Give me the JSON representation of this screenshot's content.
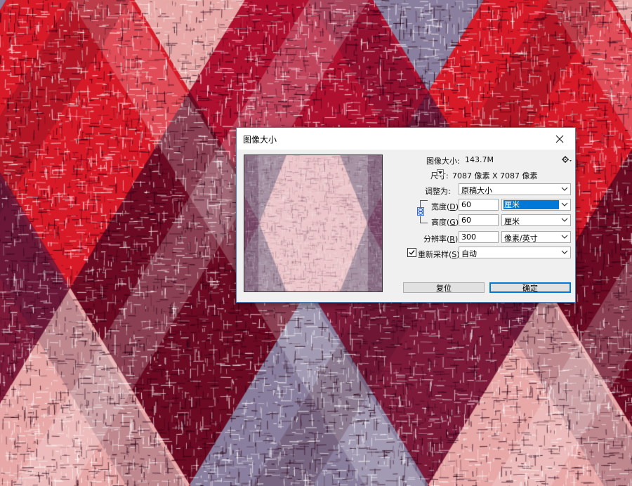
{
  "dialog": {
    "title": "图像大小",
    "image_size_label": "图像大小:",
    "image_size_value": "143.7M",
    "dimensions_label": "尺寸:",
    "dimensions_value": "7087 像素  X  7087 像素",
    "fit_to_label": "调整为:",
    "fit_to_value": "原稿大小",
    "width_label": "宽度(",
    "width_key": "D",
    "width_value": "60",
    "width_unit": "厘米",
    "height_label": "高度(",
    "height_key": "G",
    "height_value": "60",
    "height_unit": "厘米",
    "resolution_label": "分辨率(",
    "resolution_key": "R",
    "resolution_value": "300",
    "resolution_unit": "像素/英寸",
    "resample_label": "重新采样(",
    "resample_key": "S",
    "resample_checked": true,
    "resample_value": "自动",
    "label_close": "):",
    "reset_button": "复位",
    "ok_button": "确定"
  },
  "icons": {
    "close": "close-icon",
    "gear": "gear-icon",
    "link": "link-chain-icon",
    "dropdown": "chevron-down-icon",
    "dimensions_toggle": "triangle-down-icon",
    "checkmark": "checkmark-icon"
  },
  "colors": {
    "accent": "#0078d7",
    "dialog_bg": "#f0f0f0",
    "fabric_dark": "#6b0a22",
    "fabric_red": "#d81a28",
    "fabric_lavender": "#8a7f9e",
    "fabric_pink": "#e8a8a8"
  }
}
